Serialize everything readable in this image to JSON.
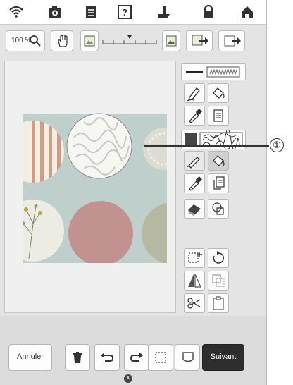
{
  "toolbar": {
    "zoom_label": "100 %"
  },
  "bottom": {
    "cancel_label": "Annuler",
    "next_label": "Suivant"
  },
  "callout": {
    "number": "①"
  },
  "colors": {
    "next_button": "#2e2e2e",
    "canvas_bg": "#bfcfcc"
  }
}
